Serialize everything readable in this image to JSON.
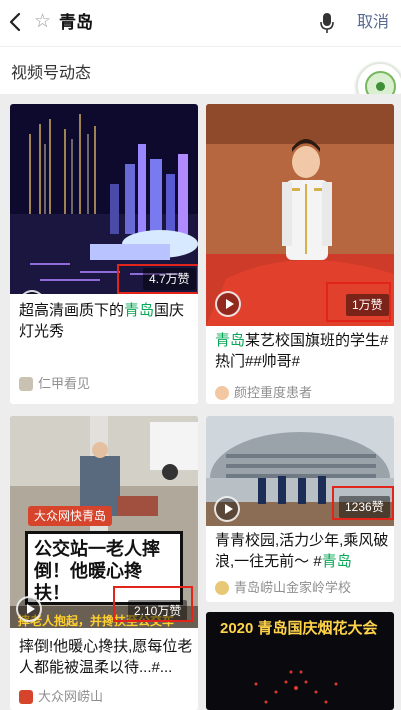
{
  "search": {
    "query": "青岛",
    "cancel_label": "取消"
  },
  "section": {
    "title": "视频号动态"
  },
  "cards": [
    {
      "title_prefix": "超高清画质下的",
      "title_highlight": "青岛",
      "title_suffix": "国庆灯光秀",
      "likes": "4.7万赞",
      "author": "仁甲看见"
    },
    {
      "title_prefix": "",
      "title_highlight": "青岛",
      "title_suffix": "某艺校国旗班的学生#热门##帅哥#",
      "likes": "1万赞",
      "author": "颜控重度患者"
    },
    {
      "title_prefix": "摔倒!他暖心搀扶,愿每位老人都能被温柔以待...#...",
      "title_highlight": "",
      "title_suffix": "",
      "likes": "2.10万赞",
      "author": "大众网崂山",
      "thumb_tag": "大众网快青岛",
      "thumb_caption": "公交站一老人摔倒！他暖心搀扶！",
      "thumb_ticker": "摔老人抱起，并搀扶至公交车"
    },
    {
      "title_prefix": "青青校园,活力少年,乘风破浪,一往无前～ #",
      "title_highlight": "青岛",
      "title_suffix": "",
      "likes": "1236赞",
      "author": "青岛崂山金家岭学校"
    },
    {
      "thumb_caption": "2020 青岛国庆烟花大会"
    }
  ],
  "colors": {
    "accent": "#07a855",
    "link": "#576b95",
    "highlight_box": "#e1251b"
  }
}
